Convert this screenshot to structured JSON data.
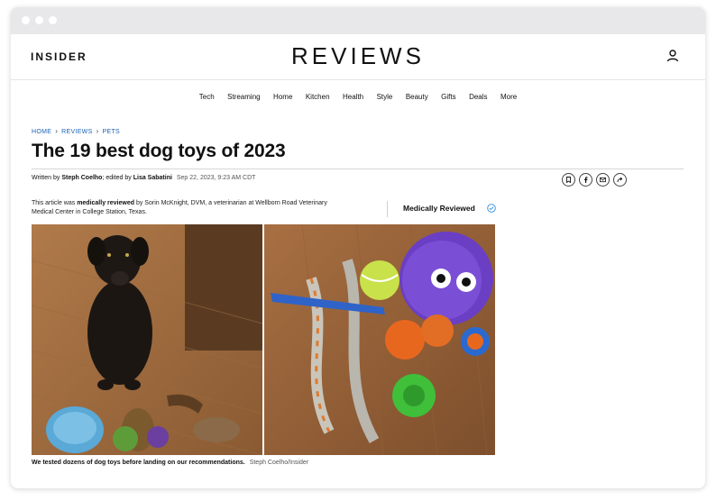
{
  "brand": {
    "left": "INSIDER",
    "center": "REVIEWS"
  },
  "nav": [
    "Tech",
    "Streaming",
    "Home",
    "Kitchen",
    "Health",
    "Style",
    "Beauty",
    "Gifts",
    "Deals",
    "More"
  ],
  "breadcrumb": [
    "HOME",
    "REVIEWS",
    "PETS"
  ],
  "article": {
    "title": "The 19 best dog toys of 2023",
    "byline_prefix": "Written by",
    "author": "Steph Coelho",
    "edited_prefix": "; edited by",
    "editor": "Lisa Sabatini",
    "date": "Sep 22, 2023, 9:23 AM CDT",
    "review_pre": "This article was",
    "review_bold": "medically reviewed",
    "review_post": "by Sorin McKnight, DVM, a veterinarian at Wellborn Road Veterinary Medical Center in College Station, Texas.",
    "review_label": "Medically Reviewed",
    "caption": "We tested dozens of dog toys before landing on our recommendations.",
    "credit": "Steph Coelho/Insider"
  },
  "icons": {
    "user": "user-icon",
    "share": [
      "bookmark-icon",
      "facebook-icon",
      "email-icon",
      "share-icon"
    ],
    "review": "check-circle-icon"
  },
  "colors": {
    "link": "#1a63b6",
    "check": "#2b8ae0",
    "titlebar": "#e8e8ea"
  }
}
